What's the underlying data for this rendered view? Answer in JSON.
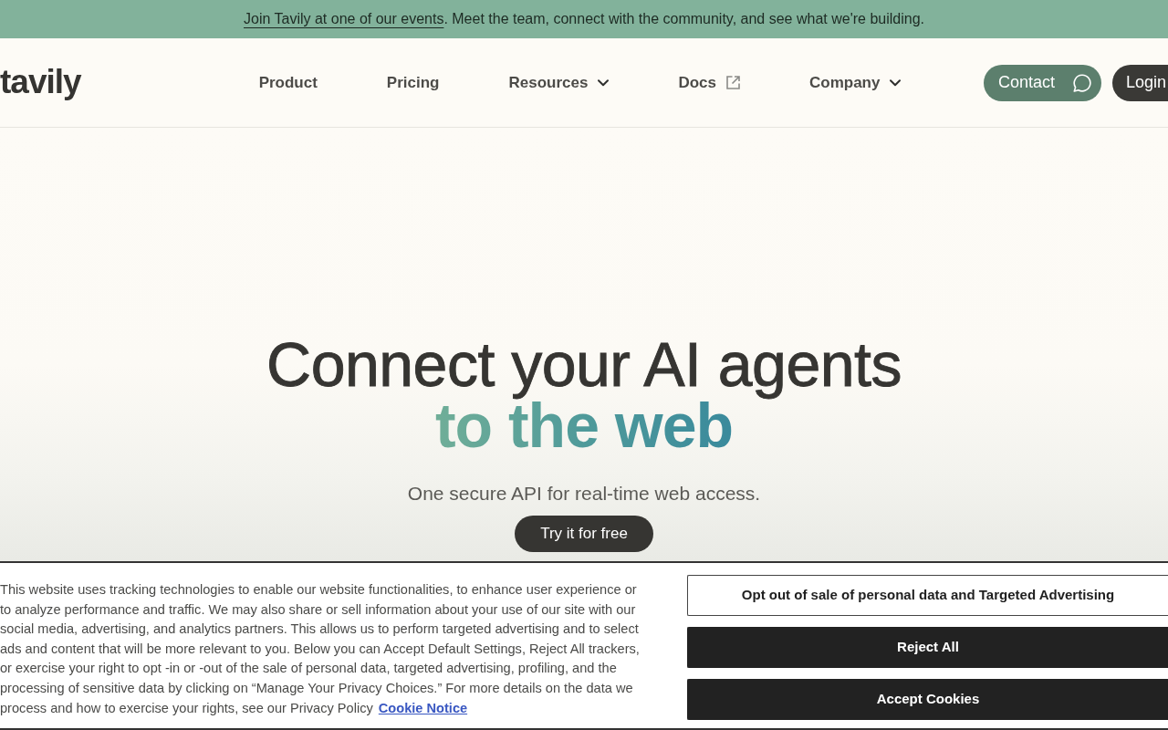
{
  "announcement": {
    "link": "Join Tavily at one of our events",
    "text": ". Meet the team, connect with the community, and see what we're building."
  },
  "navbar": {
    "logo": "tavily",
    "items": [
      {
        "label": "Product",
        "kind": "link"
      },
      {
        "label": "Pricing",
        "kind": "link"
      },
      {
        "label": "Resources",
        "kind": "dropdown"
      },
      {
        "label": "Docs",
        "kind": "external"
      },
      {
        "label": "Company",
        "kind": "dropdown"
      }
    ],
    "buttons": [
      {
        "label": "Contact",
        "kind": "contact"
      },
      {
        "label": "Login",
        "kind": "login"
      }
    ]
  },
  "hero": {
    "headline": "Connect your AI agents",
    "headline_accent": "to the web",
    "subtitle": "One secure API for real-time web access.",
    "cta": "Try it for free"
  },
  "cookie_banner": {
    "text": "This website uses tracking technologies to enable our website functionalities, to enhance user experience or to analyze performance and traffic. We may also share or sell information about your use of our site with our social media, advertising, and analytics partners. This allows us to perform targeted advertising and to select ads and content that will be more relevant to you. Below you can Accept Default Settings, Reject All trackers, or exercise your right to opt -in or -out of the sale of personal data, targeted advertising, profiling, and the processing of sensitive data by clicking on “Manage Your Privacy Choices.” For more details on the data we process and how to exercise your rights, see our Privacy Policy",
    "link": "Cookie Notice",
    "buttons": [
      {
        "label": "Opt out of sale of personal data and Targeted Advertising",
        "kind": "outline"
      },
      {
        "label": "Reject All",
        "kind": "solid"
      },
      {
        "label": "Accept Cookies",
        "kind": "solid"
      }
    ]
  }
}
